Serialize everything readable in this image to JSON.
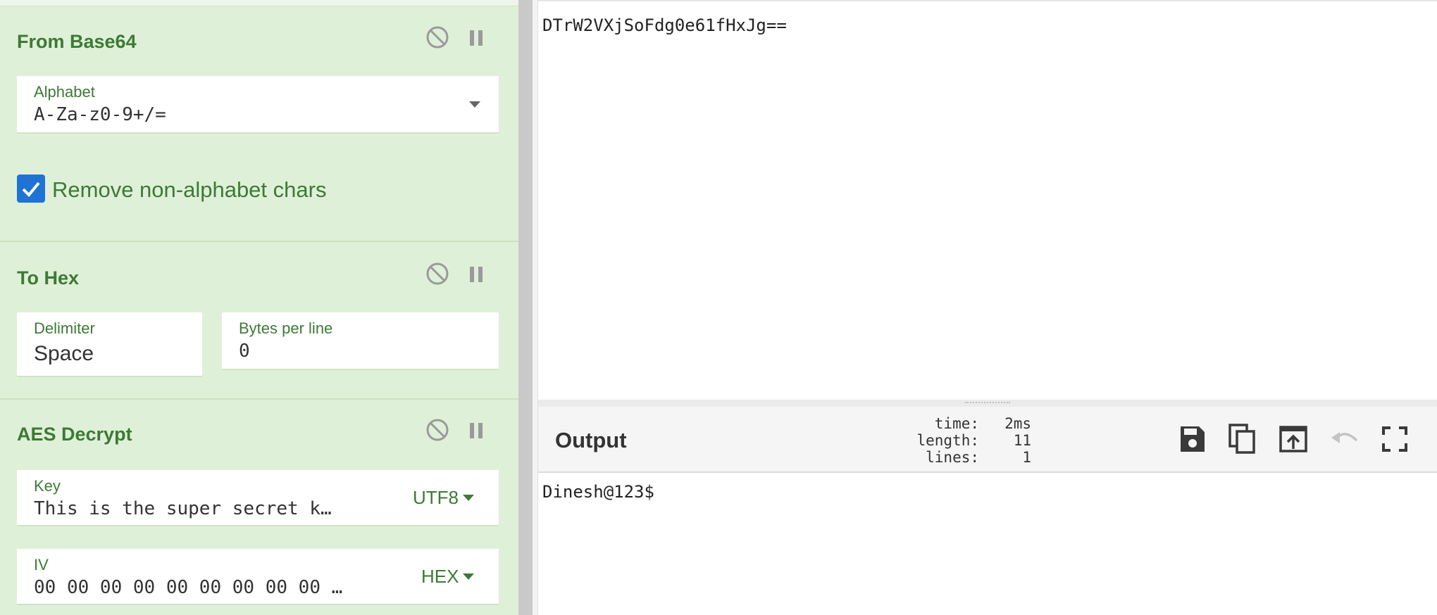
{
  "recipe": {
    "ops": [
      {
        "title": "From Base64",
        "alphabet_label": "Alphabet",
        "alphabet_value": "A-Za-z0-9+/=",
        "remove_label": "Remove non-alphabet chars"
      },
      {
        "title": "To Hex",
        "delimiter_label": "Delimiter",
        "delimiter_value": "Space",
        "bpl_label": "Bytes per line",
        "bpl_value": "0"
      },
      {
        "title": "AES Decrypt",
        "key_label": "Key",
        "key_value": "This is the super secret k…",
        "key_encoding": "UTF8",
        "iv_label": "IV",
        "iv_value": "00 00 00 00 00 00 00 00 00 …",
        "iv_encoding": "HEX"
      }
    ]
  },
  "input": {
    "text": "DTrW2VXjSoFdg0e61fHxJg=="
  },
  "output": {
    "title": "Output",
    "stats": {
      "time_label": "time:",
      "time_value": "2ms",
      "length_label": "length:",
      "length_value": "11",
      "lines_label": "lines:",
      "lines_value": "1"
    },
    "text": "Dinesh@123$"
  },
  "icons": {
    "disable": "disable-icon",
    "pause": "pause-icon",
    "save": "save-icon",
    "copy": "copy-icon",
    "replace_input": "replace-input-icon",
    "undo": "undo-icon",
    "fullscreen": "fullscreen-icon"
  },
  "colors": {
    "recipe_bg": "#dff0d8",
    "accent_green": "#3d7a35",
    "checkbox_blue": "#1f73d4"
  }
}
